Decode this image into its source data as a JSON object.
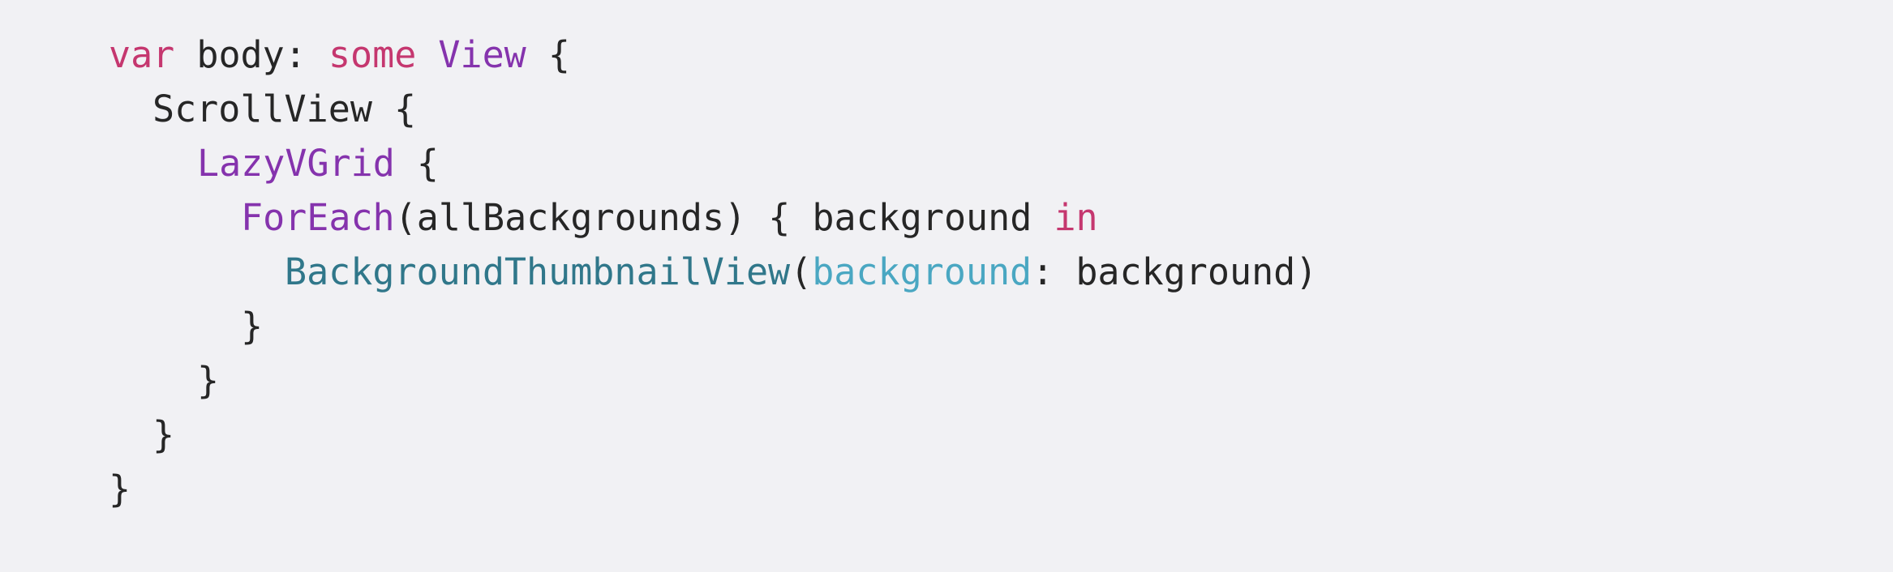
{
  "colors": {
    "background": "#f1f1f4",
    "plain_text": "#262626",
    "keyword": "#c5376f",
    "type": "#8533ad",
    "member": "#30778a",
    "parameter_label": "#4aa7c2"
  },
  "code": {
    "line1": {
      "t1": "var",
      "t2": " body: ",
      "t3": "some",
      "t4": " ",
      "t5": "View",
      "t6": " {"
    },
    "line2": {
      "t1": "ScrollView {"
    },
    "line3": {
      "t1": "LazyVGrid",
      "t2": " {"
    },
    "line4": {
      "t1": "ForEach",
      "t2": "(allBackgrounds) { background ",
      "t3": "in"
    },
    "line5": {
      "t1": "BackgroundThumbnailView",
      "t2": "(",
      "t3": "background",
      "t4": ": background)"
    },
    "line6": {
      "t1": "}"
    },
    "line7": {
      "t1": "}"
    },
    "line8": {
      "t1": "}"
    },
    "line9": {
      "t1": "}"
    }
  }
}
